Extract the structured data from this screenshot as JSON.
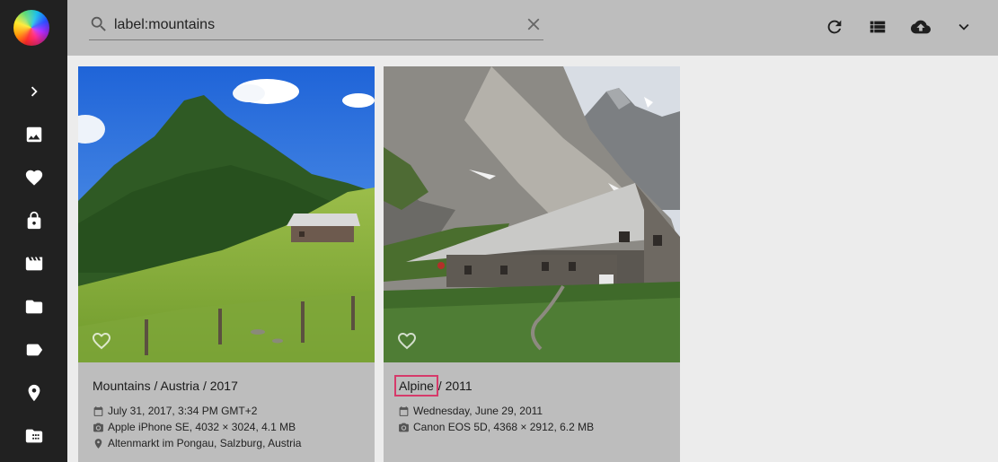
{
  "search": {
    "query": "label:mountains"
  },
  "sidebar": {
    "items": [
      {
        "icon": "chevron-right-icon",
        "label": "expand"
      },
      {
        "icon": "photo-icon",
        "label": "photos"
      },
      {
        "icon": "heart-icon",
        "label": "favorites"
      },
      {
        "icon": "lock-icon",
        "label": "private"
      },
      {
        "icon": "video-icon",
        "label": "videos"
      },
      {
        "icon": "folder-icon",
        "label": "folders"
      },
      {
        "icon": "label-icon",
        "label": "labels"
      },
      {
        "icon": "place-icon",
        "label": "places"
      },
      {
        "icon": "library-icon",
        "label": "library"
      }
    ]
  },
  "toolbar": {
    "icons": [
      "refresh-icon",
      "list-view-icon",
      "upload-icon",
      "expand-more-icon"
    ]
  },
  "cards": [
    {
      "title_main": "Mountains / Austria / 2017",
      "date": "July 31, 2017, 3:34 PM GMT+2",
      "camera": "Apple iPhone SE, 4032 × 3024, 4.1 MB",
      "location": "Altenmarkt im Pongau, Salzburg, Austria"
    },
    {
      "title_highlight": "Alpine",
      "title_rest": " / 2011",
      "date": "Wednesday, June 29, 2011",
      "camera": "Canon EOS 5D, 4368 × 2912, 6.2 MB"
    }
  ],
  "colors": {
    "sidebar": "#212121",
    "topbar": "#bdbdbd",
    "background": "#ececec",
    "highlight": "#d63a6a"
  }
}
